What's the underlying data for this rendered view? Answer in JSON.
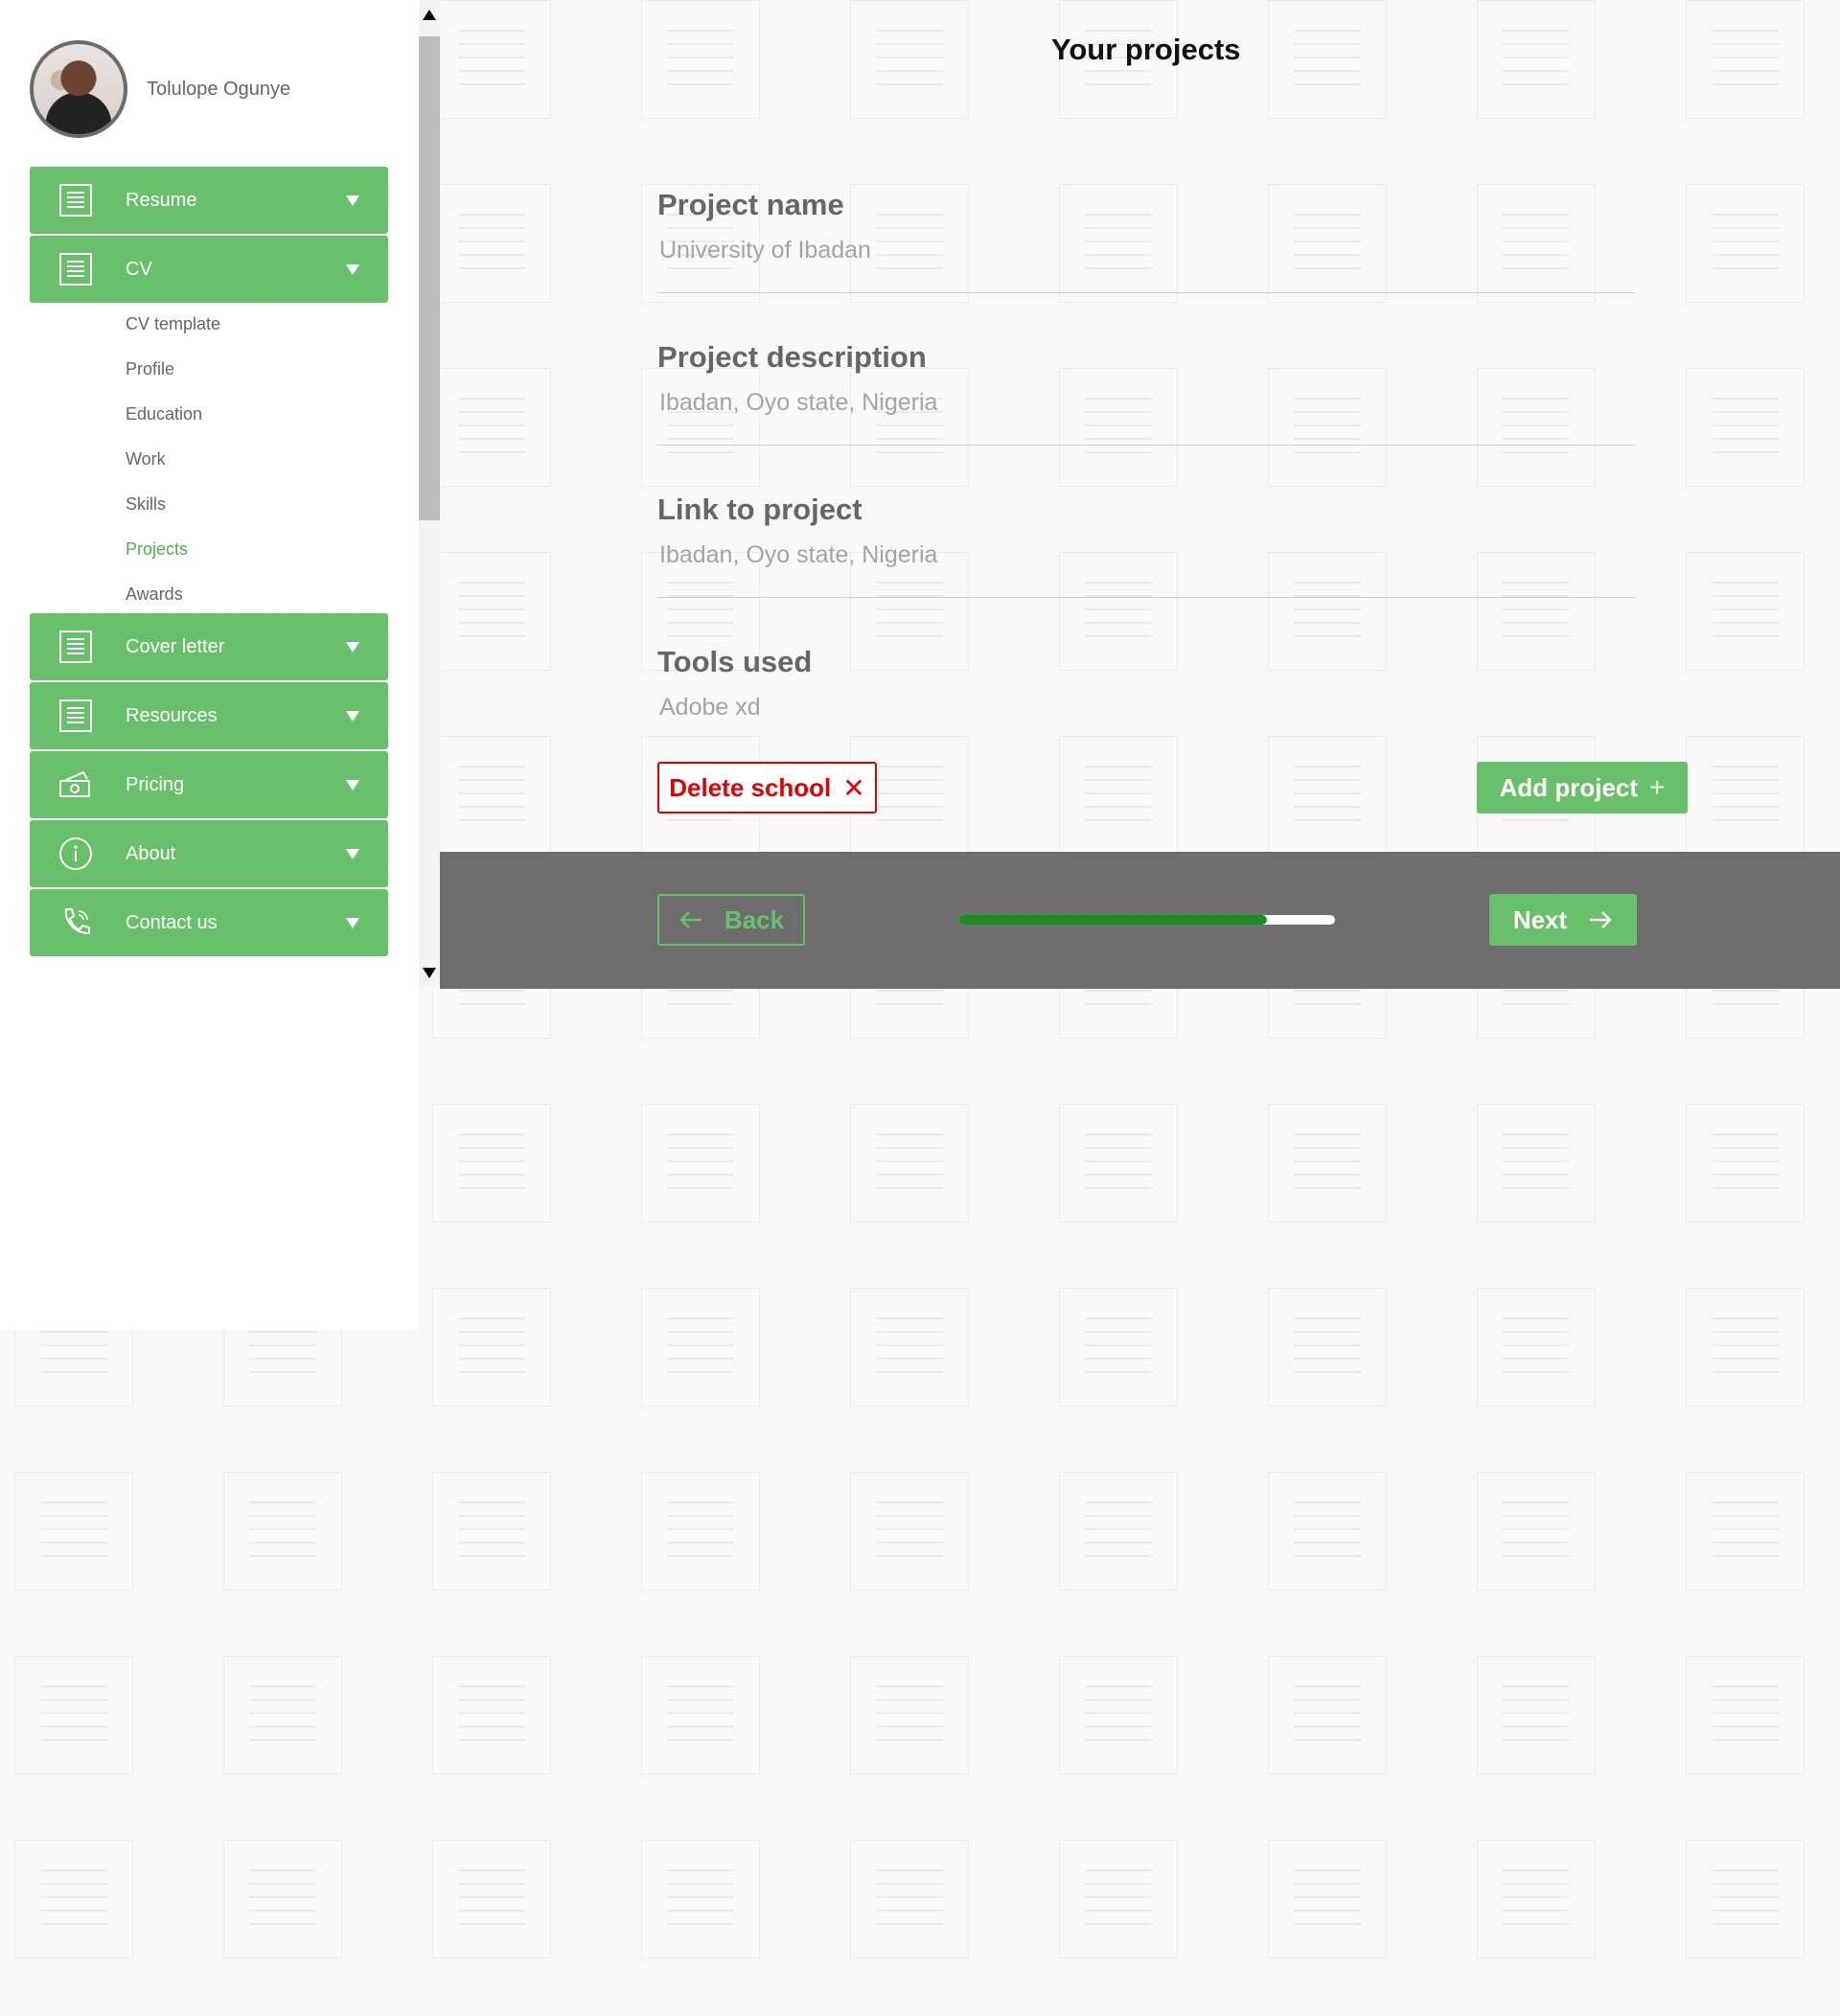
{
  "user": {
    "name": "Tolulope Ogunye"
  },
  "sidebar": {
    "groups": [
      {
        "label": "Resume",
        "icon": "document-icon"
      },
      {
        "label": "CV",
        "icon": "document-icon"
      },
      {
        "label": "Cover letter",
        "icon": "document-icon"
      },
      {
        "label": "Resources",
        "icon": "document-icon"
      },
      {
        "label": "Pricing",
        "icon": "money-icon"
      },
      {
        "label": "About",
        "icon": "info-icon"
      },
      {
        "label": "Contact us",
        "icon": "phone-icon"
      }
    ],
    "cv_items": [
      "CV template",
      "Profile",
      "Education",
      "Work",
      "Skills",
      "Projects",
      "Awards"
    ],
    "active_item": "Projects"
  },
  "main": {
    "title": "Your projects",
    "fields": [
      {
        "label": "Project name",
        "value": "University of Ibadan"
      },
      {
        "label": "Project description",
        "value": "Ibadan, Oyo state, Nigeria"
      },
      {
        "label": "Link to project",
        "value": "Ibadan, Oyo state, Nigeria"
      },
      {
        "label": "Tools used",
        "value": "Adobe xd"
      }
    ],
    "delete_label": "Delete school",
    "add_label": "Add project"
  },
  "footer": {
    "back_label": "Back",
    "next_label": "Next",
    "progress": 0.82
  },
  "colors": {
    "accent": "#69c06b",
    "danger": "#e10000",
    "footer_bg": "#6e6e6e",
    "progress_fill": "#1e8a24"
  }
}
